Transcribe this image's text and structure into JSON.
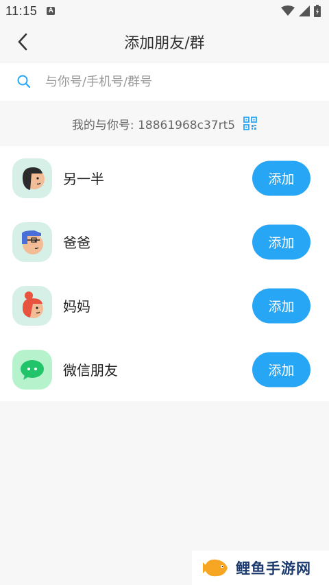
{
  "status": {
    "time": "11:15",
    "notification_glyph": "A"
  },
  "header": {
    "title": "添加朋友/群",
    "back_icon": "chevron-left-icon"
  },
  "search": {
    "placeholder": "与你号/手机号/群号",
    "value": ""
  },
  "my_id": {
    "text": "我的与你号: 18861968c37rt5",
    "icon": "qr-code-icon"
  },
  "contacts": [
    {
      "label": "另一半",
      "button": "添加",
      "avatar": "woman-avatar",
      "bg": "#d6efe7"
    },
    {
      "label": "爸爸",
      "button": "添加",
      "avatar": "dad-avatar",
      "bg": "#d6efe7"
    },
    {
      "label": "妈妈",
      "button": "添加",
      "avatar": "mom-avatar",
      "bg": "#d6efe7"
    },
    {
      "label": "微信朋友",
      "button": "添加",
      "avatar": "wechat-avatar",
      "bg": "#b6f3cc"
    }
  ],
  "watermark": {
    "text": "鲤鱼手游网"
  },
  "colors": {
    "accent": "#27a6f5",
    "background": "#f7f7f7",
    "wechat": "#22c46a"
  }
}
